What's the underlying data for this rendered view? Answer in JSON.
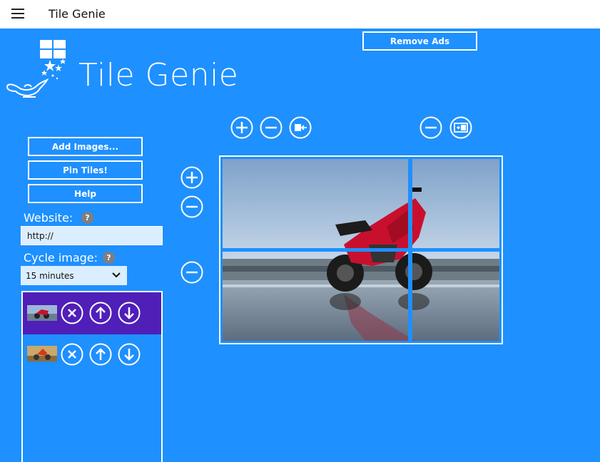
{
  "window": {
    "title": "Tile Genie"
  },
  "brand": {
    "name": "Tile Genie"
  },
  "header": {
    "remove_ads_label": "Remove Ads"
  },
  "sidebar": {
    "add_images_label": "Add Images...",
    "pin_tiles_label": "Pin Tiles!",
    "help_label": "Help",
    "website_label": "Website:",
    "website_value": "http://",
    "cycle_label": "Cycle image:",
    "cycle_value": "15 minutes",
    "help_badge": "?"
  },
  "image_list": {
    "items": [
      {
        "selected": true,
        "subject": "red motorcycle thumbnail"
      },
      {
        "selected": false,
        "subject": "motocross rider thumbnail"
      }
    ]
  },
  "icons": {
    "add": "plus-circle-icon",
    "remove": "minus-circle-icon",
    "move_left": "shrink-left-icon",
    "move_right": "expand-right-icon",
    "delete": "x-circle-icon",
    "up": "arrow-up-circle-icon",
    "down": "arrow-down-circle-icon"
  },
  "colors": {
    "background": "#1e90ff",
    "selected_row": "#4f1fb8",
    "input_bg": "#dbeeff",
    "help_badge": "#7f7f7f"
  }
}
